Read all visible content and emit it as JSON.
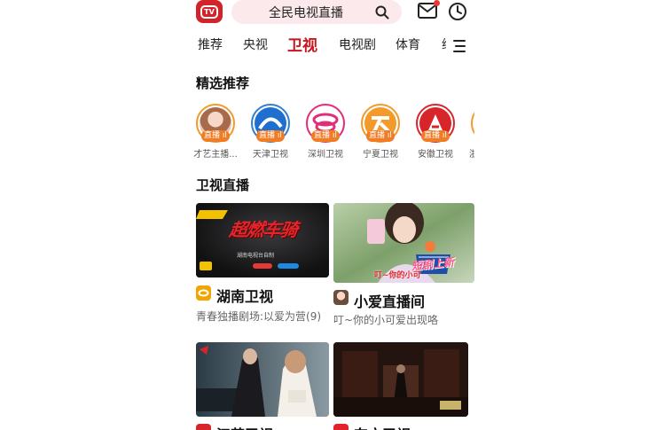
{
  "header": {
    "logo_text": "TV",
    "search_text": "全民电视直播"
  },
  "tabs": [
    "推荐",
    "央视",
    "卫视",
    "电视剧",
    "体育",
    "综"
  ],
  "active_tab_index": 2,
  "featured": {
    "title": "精选推荐",
    "items": [
      {
        "label": "才艺主播...",
        "badge": "直播"
      },
      {
        "label": "天津卫视",
        "badge": "直播"
      },
      {
        "label": "深圳卫视",
        "badge": "直播"
      },
      {
        "label": "宁夏卫视",
        "badge": "直播"
      },
      {
        "label": "安徽卫视",
        "badge": "直播"
      },
      {
        "label": "浙",
        "badge": ""
      }
    ]
  },
  "live": {
    "title": "卫视直播",
    "cards": [
      {
        "name": "湖南卫视",
        "subtitle": "青春独播剧场:以爱为营(9)",
        "thumb_title": "超燃车骑",
        "thumb_caption": "湖南电视台自制"
      },
      {
        "name": "小爱直播间",
        "subtitle": "叮~你的小可爱出现咯",
        "thumb_overlay": "叮~你的小可",
        "thumb_badge": "短剧上新"
      },
      {
        "name": "江苏卫视",
        "subtitle": ""
      },
      {
        "name": "东方卫视",
        "subtitle": ""
      }
    ]
  },
  "colors": {
    "accent": "#c9151e",
    "live_badge": "#f07c26",
    "search_bg": "#fbe9ec"
  }
}
